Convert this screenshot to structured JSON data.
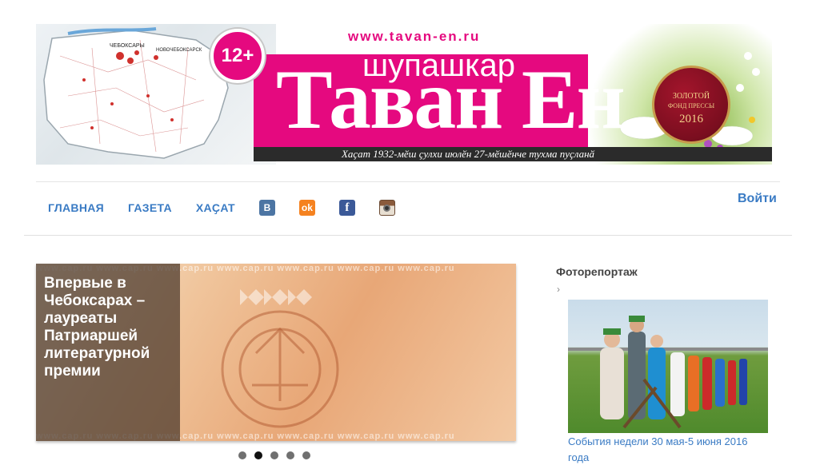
{
  "banner": {
    "url": "www.tavan-en.ru",
    "age_rating": "12+",
    "subtitle": "шупашкар",
    "title": "Таван Ен",
    "tagline": "Хаҫат 1932-мӗш ҫулхи июлӗн 27-мӗшӗнче тухма пуҫланӑ",
    "seal": {
      "line1": "ЗОЛОТОЙ",
      "line2": "ФОНД ПРЕССЫ",
      "year": "2016"
    },
    "map_labels": {
      "city1": "ЧЕБОКСАРЫ",
      "city2": "НОВОЧЕБОКСАРСК"
    }
  },
  "nav": {
    "items": [
      {
        "label": "ГЛАВНАЯ"
      },
      {
        "label": "ГАЗЕТА"
      },
      {
        "label": "ХАҪАТ"
      }
    ],
    "social": {
      "vk": "В",
      "ok": "ok",
      "fb": "f"
    },
    "login_label": "Войти"
  },
  "slider": {
    "caption": "Впервые в Чебоксарах – лауреаты Патриаршей литературной премии",
    "watermark": "www.cap.ru",
    "slide_count": 5,
    "active_index": 1
  },
  "sidebar": {
    "title": "Фоторепортаж",
    "chevron": "›",
    "photo_caption": "События недели 30 мая-5 июня 2016 года"
  },
  "colors": {
    "brand_pink": "#e5097f",
    "link_blue": "#3a7bc4"
  }
}
